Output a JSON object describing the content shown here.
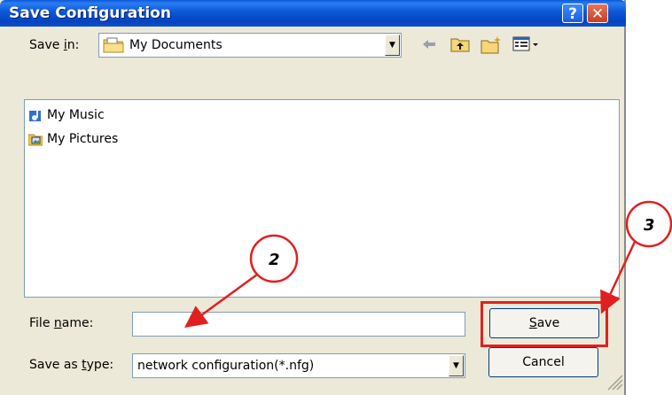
{
  "window": {
    "title": "Save Configuration",
    "help_label": "?",
    "close_label": "✕"
  },
  "save_in": {
    "label_pre": "Save ",
    "label_ul": "i",
    "label_post": "n:",
    "value": "My Documents"
  },
  "files": [
    {
      "name": "My Music",
      "icon": "music-folder-icon"
    },
    {
      "name": "My Pictures",
      "icon": "pictures-folder-icon"
    }
  ],
  "file_name": {
    "label_pre": "File ",
    "label_ul": "n",
    "label_post": "ame:",
    "value": ""
  },
  "save_as_type": {
    "label_pre": "Save as ",
    "label_ul": "t",
    "label_post": "ype:",
    "value": "network configuration(*.nfg)"
  },
  "buttons": {
    "save_ul": "S",
    "save_post": "ave",
    "cancel": "Cancel"
  },
  "annotations": {
    "step_2": "2",
    "step_3": "3",
    "highlight_color": "#e02020"
  }
}
